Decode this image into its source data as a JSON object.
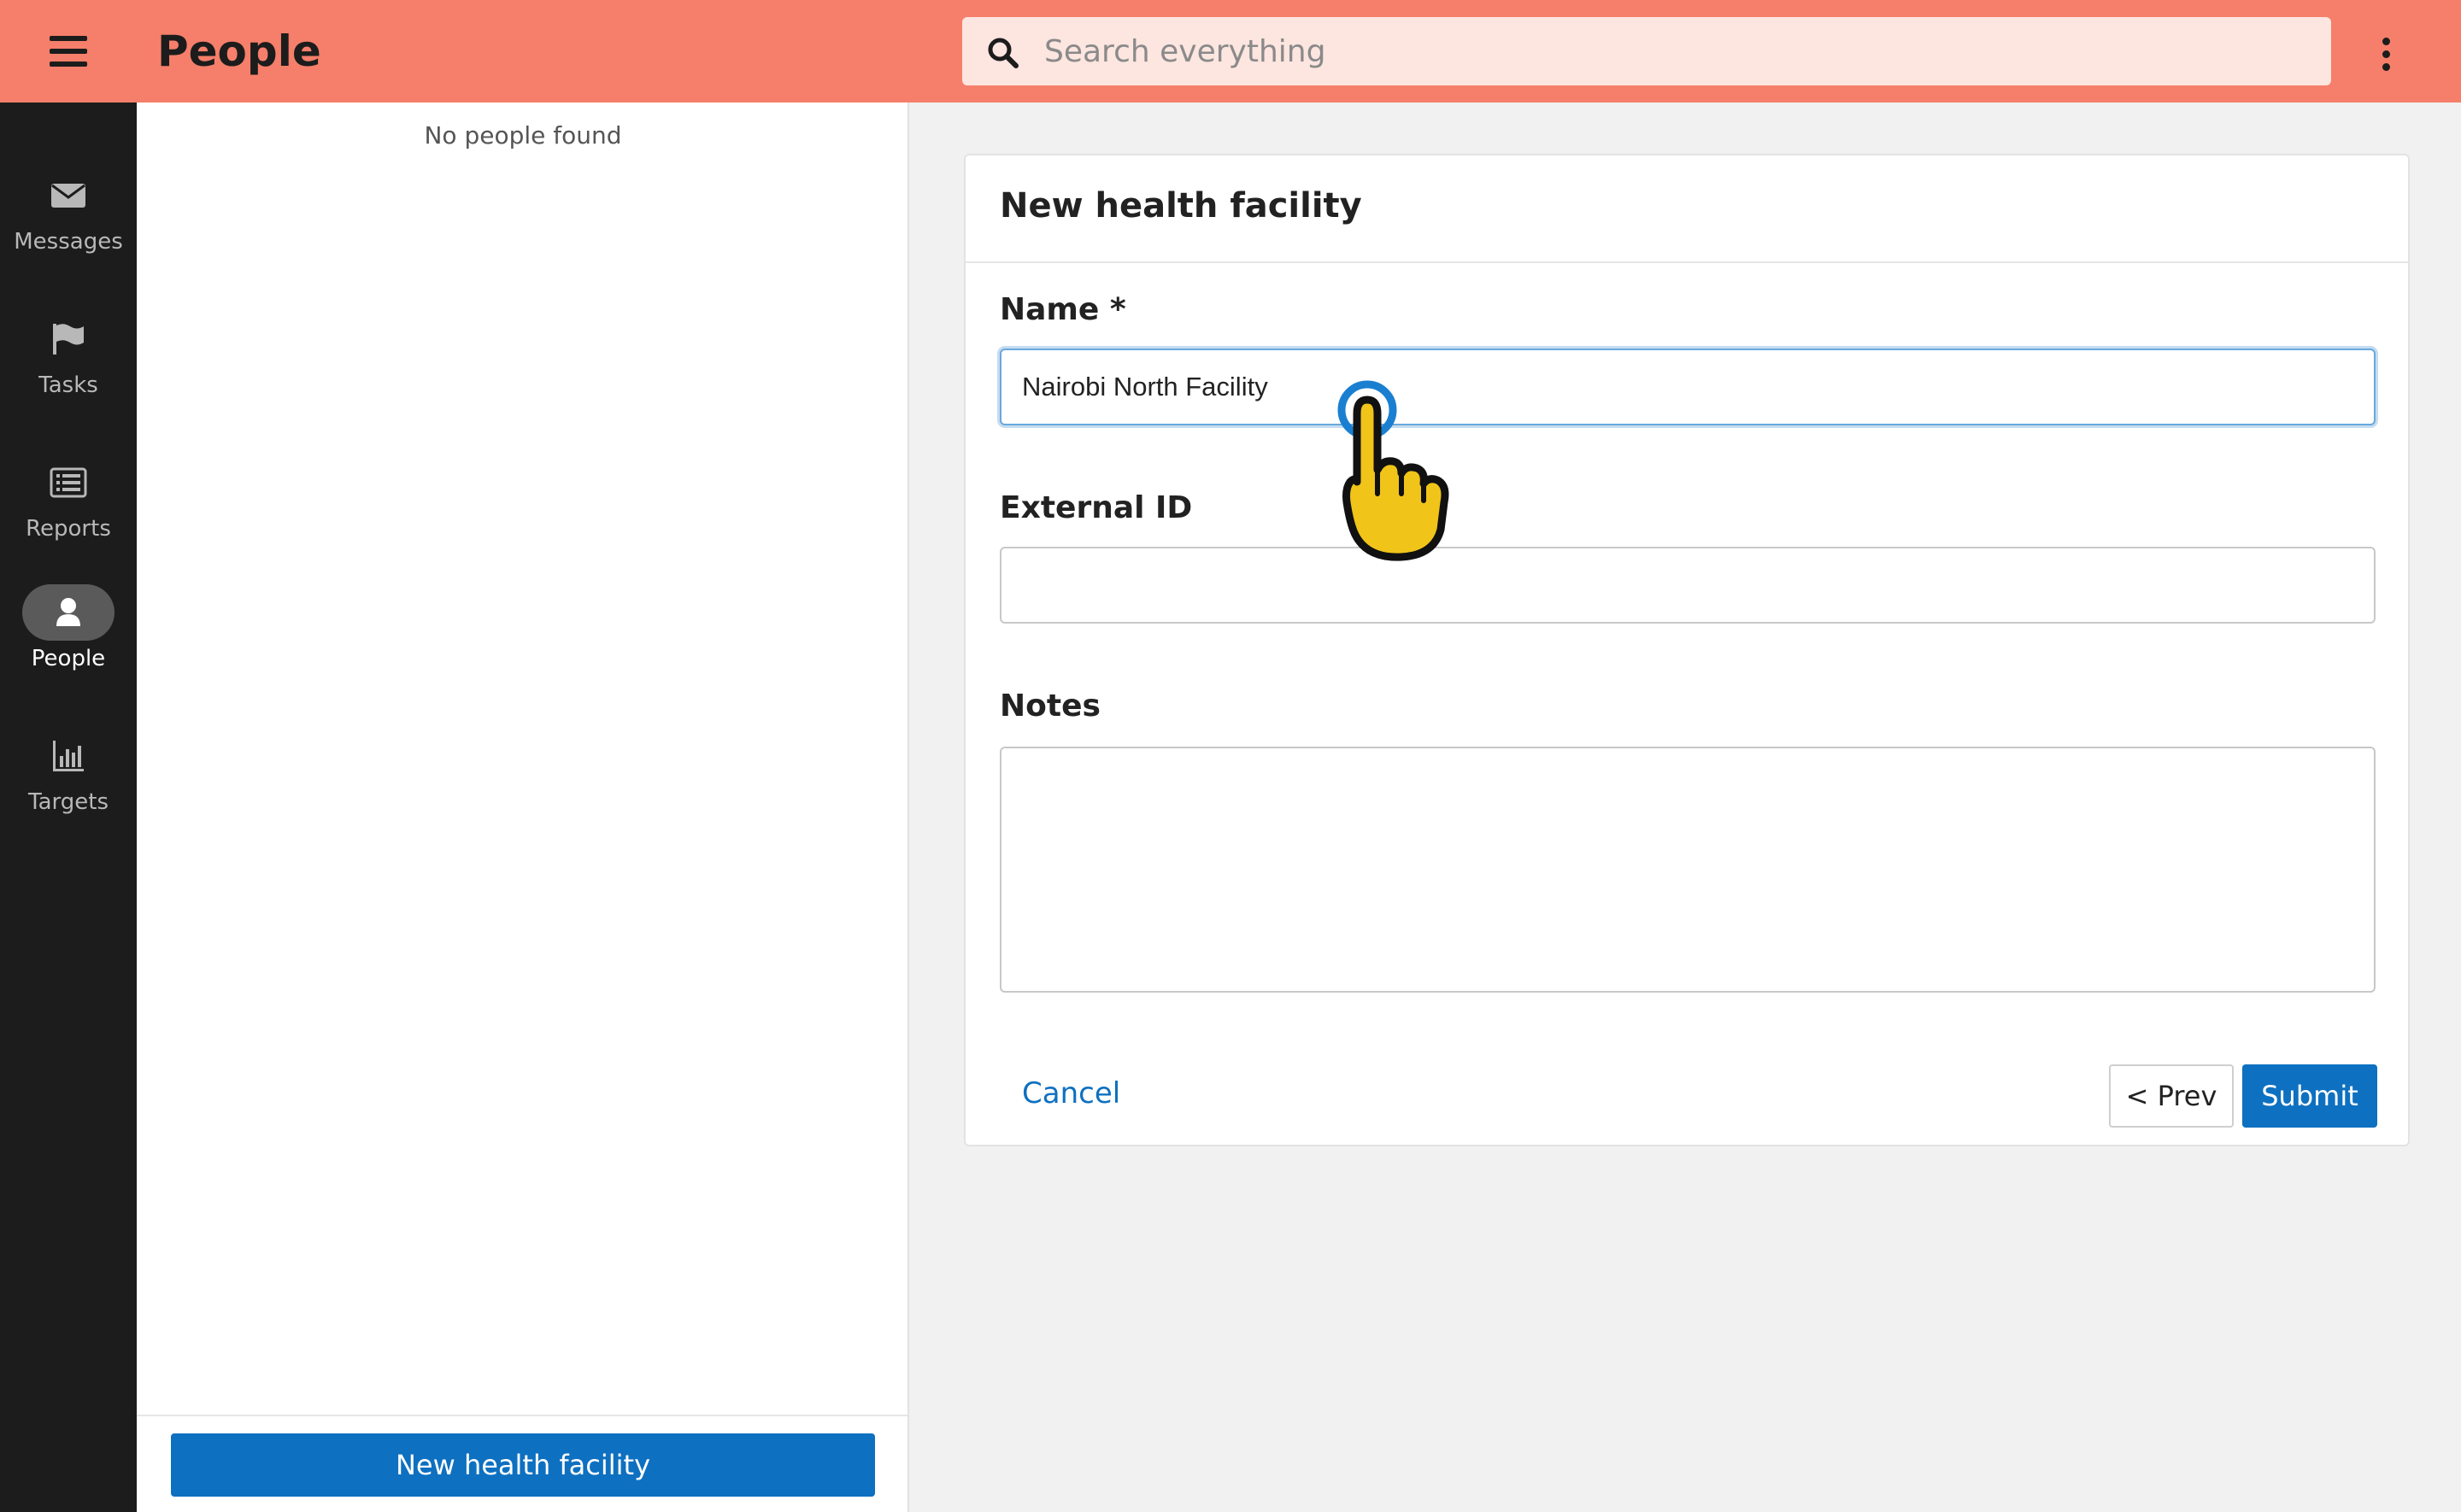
{
  "header": {
    "title": "People",
    "search_placeholder": "Search everything",
    "menu_icon": "hamburger-icon",
    "more_icon": "kebab-menu-icon"
  },
  "sidebar": {
    "items": [
      {
        "label": "Messages",
        "icon": "envelope-icon",
        "active": false
      },
      {
        "label": "Tasks",
        "icon": "flag-icon",
        "active": false
      },
      {
        "label": "Reports",
        "icon": "list-icon",
        "active": false
      },
      {
        "label": "People",
        "icon": "person-icon",
        "active": true
      },
      {
        "label": "Targets",
        "icon": "bar-chart-icon",
        "active": false
      }
    ]
  },
  "list": {
    "empty_message": "No people found",
    "new_button_label": "New health facility"
  },
  "form": {
    "title": "New health facility",
    "name_label": "Name *",
    "name_value": "Nairobi North Facility",
    "external_id_label": "External ID",
    "external_id_value": "",
    "notes_label": "Notes",
    "notes_value": "",
    "cancel_label": "Cancel",
    "prev_label": "< Prev",
    "submit_label": "Submit"
  },
  "colors": {
    "header_bg": "#f57f6a",
    "search_bg": "#fde5e0",
    "sidebar_bg": "#1c1c1c",
    "primary": "#0e70c0",
    "cursor_fill": "#f0c419"
  }
}
